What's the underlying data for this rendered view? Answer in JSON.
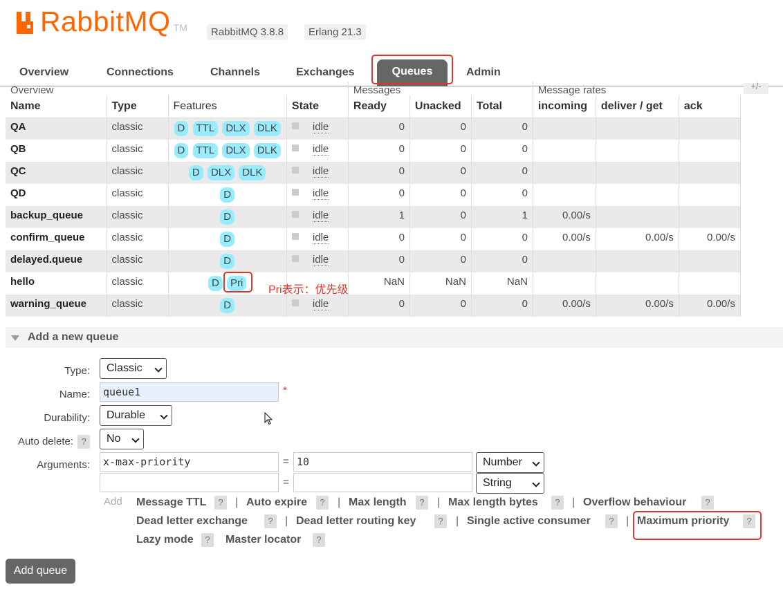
{
  "header": {
    "logo_text": "RabbitMQ",
    "logo_tm": "TM",
    "version_rabbit": "RabbitMQ 3.8.8",
    "version_erlang": "Erlang 21.3",
    "brand_color": "#ff6600"
  },
  "tabs": [
    {
      "label": "Overview"
    },
    {
      "label": "Connections"
    },
    {
      "label": "Channels"
    },
    {
      "label": "Exchanges"
    },
    {
      "label": "Queues",
      "active": true
    },
    {
      "label": "Admin"
    }
  ],
  "table": {
    "group_headers": {
      "overview": "Overview",
      "messages": "Messages",
      "message_rates": "Message rates",
      "plus_minus": "+/-"
    },
    "columns": [
      "Name",
      "Type",
      "Features",
      "State",
      "Ready",
      "Unacked",
      "Total",
      "incoming",
      "deliver / get",
      "ack"
    ],
    "rows": [
      {
        "name": "QA",
        "type": "classic",
        "features": [
          "D",
          "TTL",
          "DLX",
          "DLK"
        ],
        "state": "idle",
        "ready": "0",
        "unacked": "0",
        "total": "0",
        "incoming": "",
        "deliver_get": "",
        "ack": ""
      },
      {
        "name": "QB",
        "type": "classic",
        "features": [
          "D",
          "TTL",
          "DLX",
          "DLK"
        ],
        "state": "idle",
        "ready": "0",
        "unacked": "0",
        "total": "0",
        "incoming": "",
        "deliver_get": "",
        "ack": ""
      },
      {
        "name": "QC",
        "type": "classic",
        "features": [
          "D",
          "DLX",
          "DLK"
        ],
        "state": "idle",
        "ready": "0",
        "unacked": "0",
        "total": "0",
        "incoming": "",
        "deliver_get": "",
        "ack": ""
      },
      {
        "name": "QD",
        "type": "classic",
        "features": [
          "D"
        ],
        "state": "idle",
        "ready": "0",
        "unacked": "0",
        "total": "0",
        "incoming": "",
        "deliver_get": "",
        "ack": ""
      },
      {
        "name": "backup_queue",
        "type": "classic",
        "features": [
          "D"
        ],
        "state": "idle",
        "ready": "1",
        "unacked": "0",
        "total": "1",
        "incoming": "0.00/s",
        "deliver_get": "",
        "ack": ""
      },
      {
        "name": "confirm_queue",
        "type": "classic",
        "features": [
          "D"
        ],
        "state": "idle",
        "ready": "0",
        "unacked": "0",
        "total": "0",
        "incoming": "0.00/s",
        "deliver_get": "0.00/s",
        "ack": "0.00/s"
      },
      {
        "name": "delayed.queue",
        "type": "classic",
        "features": [
          "D"
        ],
        "state": "idle",
        "ready": "0",
        "unacked": "0",
        "total": "0",
        "incoming": "",
        "deliver_get": "",
        "ack": ""
      },
      {
        "name": "hello",
        "type": "classic",
        "features": [
          "D",
          "Pri"
        ],
        "state": "",
        "ready": "NaN",
        "unacked": "NaN",
        "total": "NaN",
        "incoming": "",
        "deliver_get": "",
        "ack": ""
      },
      {
        "name": "warning_queue",
        "type": "classic",
        "features": [
          "D"
        ],
        "state": "idle",
        "ready": "0",
        "unacked": "0",
        "total": "0",
        "incoming": "0.00/s",
        "deliver_get": "0.00/s",
        "ack": "0.00/s"
      }
    ],
    "annotation": "Pri表示：优先级"
  },
  "add_queue": {
    "section_title": "Add a new queue",
    "type_label": "Type:",
    "type_value": "Classic",
    "name_label": "Name:",
    "name_value": "queue1",
    "required_mark": "*",
    "durability_label": "Durability:",
    "durability_value": "Durable",
    "auto_delete_label": "Auto delete:",
    "auto_delete_value": "No",
    "help_mark": "?",
    "arguments_label": "Arguments:",
    "equals": "=",
    "args": [
      {
        "key": "x-max-priority",
        "value": "10",
        "type": "Number"
      },
      {
        "key": "",
        "value": "",
        "type": "String"
      }
    ],
    "add_hint": "Add",
    "arg_links": [
      "Message TTL",
      "Auto expire",
      "Max length",
      "Max length bytes",
      "Overflow behaviour",
      "Dead letter exchange",
      "Dead letter routing key",
      "Single active consumer",
      "Maximum priority",
      "Lazy mode",
      "Master locator"
    ],
    "separator": "|",
    "submit_label": "Add queue"
  }
}
